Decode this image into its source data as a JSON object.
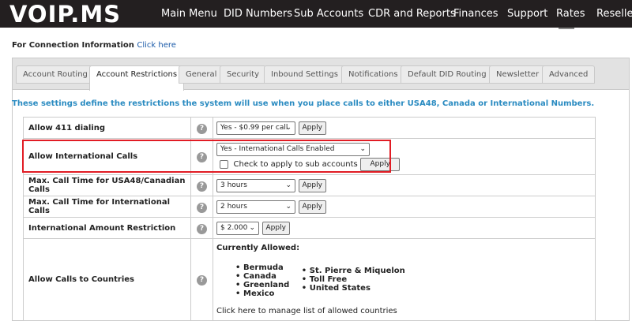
{
  "logo": {
    "text": "VOIP.MS"
  },
  "nav": {
    "items": [
      {
        "label": "Main Menu"
      },
      {
        "label": "DID Numbers"
      },
      {
        "label": "Sub Accounts"
      },
      {
        "label": "CDR and Reports"
      },
      {
        "label": "Finances"
      },
      {
        "label": "Support"
      },
      {
        "label": "Rates"
      },
      {
        "label": "Reseller"
      }
    ]
  },
  "connection": {
    "label": "For Connection Information",
    "link": "Click here"
  },
  "tabs": [
    {
      "label": "Account Routing"
    },
    {
      "label": "Account Restrictions",
      "active": true
    },
    {
      "label": "General"
    },
    {
      "label": "Security"
    },
    {
      "label": "Inbound Settings"
    },
    {
      "label": "Notifications"
    },
    {
      "label": "Default DID Routing"
    },
    {
      "label": "Newsletter"
    },
    {
      "label": "Advanced"
    }
  ],
  "intro": "These settings define the restrictions the system will use when you place calls to either USA48, Canada or International Numbers.",
  "settings": {
    "allow_411": {
      "label": "Allow 411 dialing",
      "value": "Yes - $0.99 per call",
      "apply": "Apply"
    },
    "international": {
      "label": "Allow International Calls",
      "value": "Yes - International Calls Enabled",
      "sub_accounts": "Check to apply to sub accounts",
      "apply": "Apply"
    },
    "max_usa": {
      "label": "Max. Call Time for USA48/Canadian Calls",
      "value": "3 hours",
      "apply": "Apply"
    },
    "max_intl": {
      "label": "Max. Call Time for International Calls",
      "value": "2 hours",
      "apply": "Apply"
    },
    "amount": {
      "label": "International Amount Restriction",
      "value": "$ 2.000",
      "apply": "Apply"
    },
    "countries": {
      "label": "Allow Calls to Countries",
      "title": "Currently Allowed:",
      "col1": [
        "Bermuda",
        "Canada",
        "Greenland",
        "Mexico"
      ],
      "col2": [
        "St. Pierre & Miquelon",
        "Toll Free",
        "United States"
      ],
      "manage": "Click here to manage list of allowed countries"
    }
  },
  "help_glyph": "?",
  "colors": {
    "nav_bg": "#231f20",
    "intro": "#2a8bc1",
    "highlight": "#e11c24",
    "link": "#1a5aa8"
  }
}
